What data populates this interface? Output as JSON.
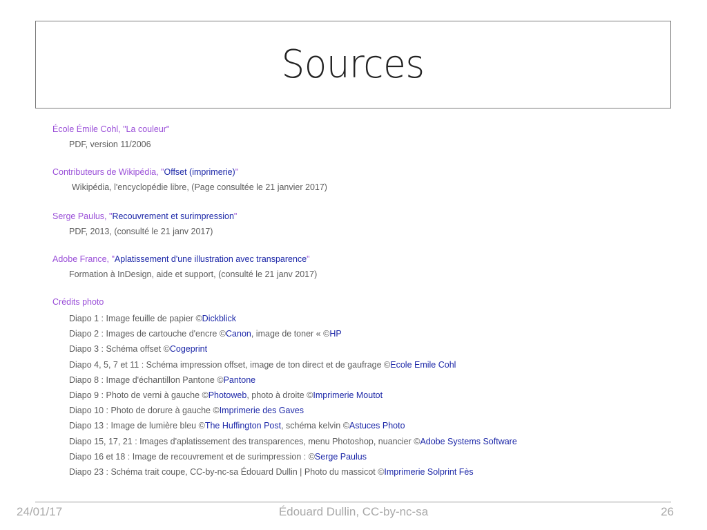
{
  "slide": {
    "title": "Sources"
  },
  "sources": [
    {
      "prefix": "École Émile Cohl, \"La couleur\"",
      "link": "",
      "suffix": "",
      "detail": "PDF, version 11/2006"
    },
    {
      "prefix": "Contributeurs de Wikipédia, \"",
      "link": "Offset (imprimerie)",
      "suffix": "\"",
      "detail": "Wikipédia, l'encyclopédie libre, (Page consultée le 21 janvier 2017)"
    },
    {
      "prefix": "Serge Paulus, \"",
      "link": "Recouvrement et surimpression",
      "suffix": "\"",
      "detail": "PDF, 2013, (consulté le 21 janv 2017)"
    },
    {
      "prefix": "Adobe France, \"",
      "link": "Aplatissement d'une illustration avec transparence",
      "suffix": "\"",
      "detail": "Formation à InDesign, aide et support, (consulté le 21 janv 2017)"
    }
  ],
  "credits": {
    "heading": "Crédits photo",
    "items": [
      {
        "a": "Diapo 1 : Image feuille de papier ©",
        "b": "Dickblick",
        "c": "",
        "d": ""
      },
      {
        "a": "Diapo 2 : Images de cartouche d'encre ©",
        "b": "Canon",
        "c": ", image de toner « ©",
        "d": "HP"
      },
      {
        "a": "Diapo 3 : Schéma offset ©",
        "b": "Cogeprint",
        "c": "",
        "d": ""
      },
      {
        "a": "Diapo 4, 5, 7 et 11 : Schéma impression offset, image de ton direct et de gaufrage ©",
        "b": "Ecole Emile Cohl",
        "c": "",
        "d": ""
      },
      {
        "a": "Diapo 8 : Image d'échantillon Pantone ©",
        "b": "Pantone",
        "c": "",
        "d": ""
      },
      {
        "a": "Diapo 9 : Photo de verni à gauche ©",
        "b": "Photoweb",
        "c": ", photo à droite ©",
        "d": "Imprimerie Moutot"
      },
      {
        "a": "Diapo 10 : Photo de dorure à gauche ©",
        "b": "Imprimerie des Gaves",
        "c": "",
        "d": ""
      },
      {
        "a": "Diapo 13 : Image de lumière bleu ©",
        "b": "The Huffington Post",
        "c": ", schéma kelvin ©",
        "d": "Astuces Photo"
      },
      {
        "a": "Diapo 15, 17, 21 :  Images d'aplatissement des transparences, menu Photoshop, nuancier ©",
        "b": "Adobe Systems Software",
        "c": "",
        "d": ""
      },
      {
        "a": "Diapo 16 et 18 : Image de recouvrement et de surimpression : ©",
        "b": "Serge Paulus",
        "c": "",
        "d": ""
      },
      {
        "a": "Diapo 23 : Schéma trait coupe, CC-by-nc-sa Édouard Dullin | Photo du massicot ©",
        "b": "Imprimerie Solprint Fès",
        "c": "",
        "d": ""
      }
    ]
  },
  "footer": {
    "date": "24/01/17",
    "author": "Édouard Dullin, CC-by-nc-sa",
    "page": "26"
  },
  "colors": {
    "heading": "#9a4fd8",
    "link": "#1d28a8",
    "detail": "#5c5c5c",
    "footer": "#a9a9a9"
  }
}
